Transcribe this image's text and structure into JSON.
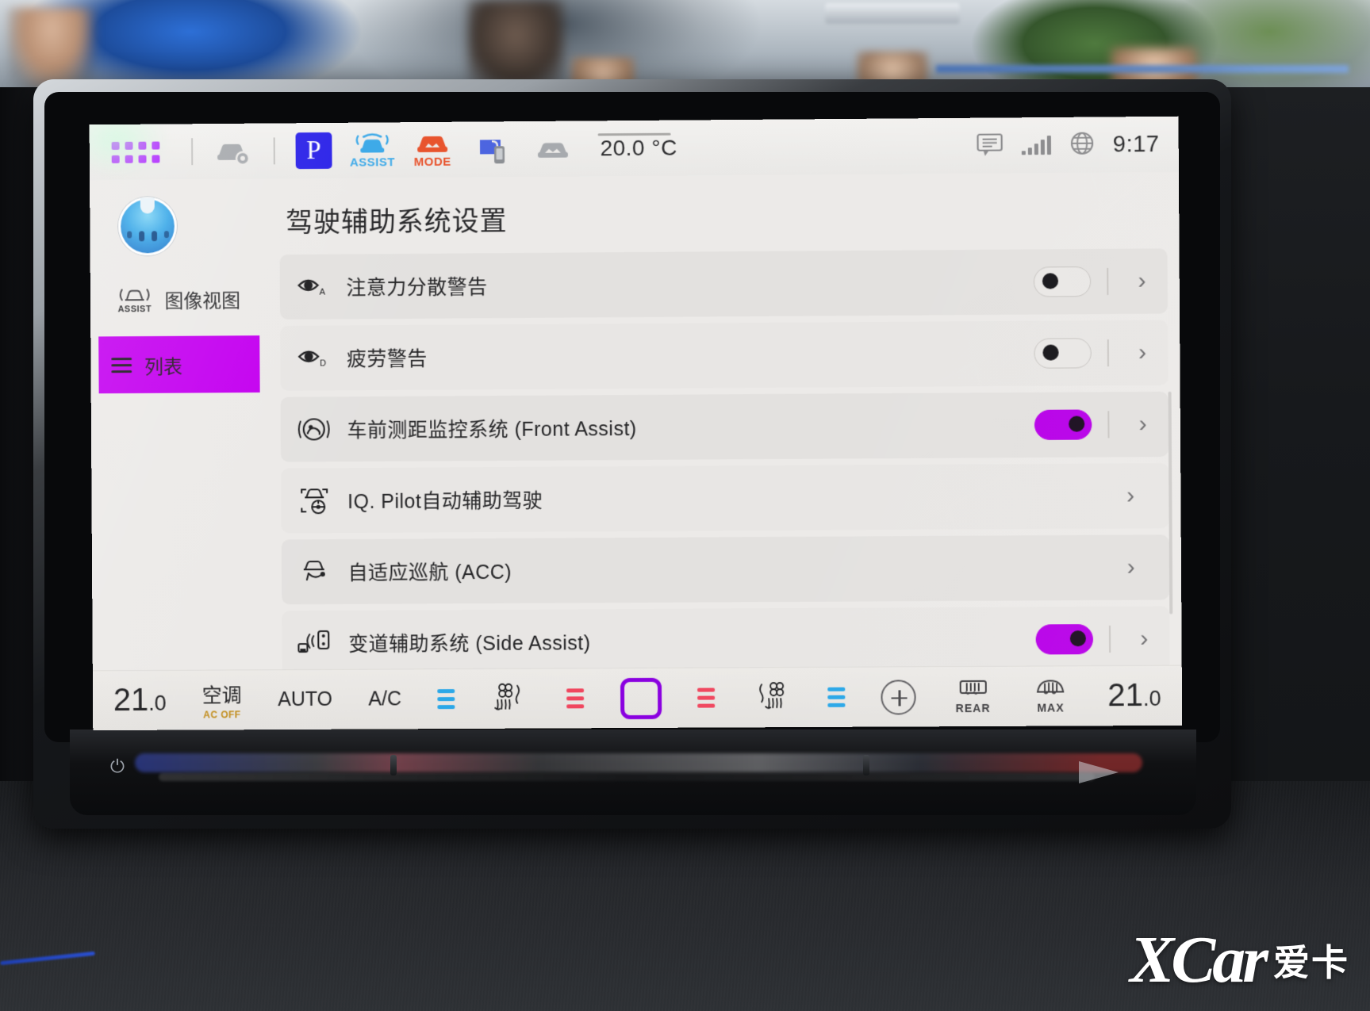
{
  "status_bar": {
    "apps_icon": "app-grid-icon",
    "car_settings_icon": "car-settings-icon",
    "park_label": "P",
    "assist_label": "ASSIST",
    "mode_label": "MODE",
    "phone_icon": "phone-projection-icon",
    "car_icon": "car-front-icon",
    "temperature": "20.0 °C",
    "message_icon": "message-icon",
    "signal_icon": "signal-bars-icon",
    "globe_icon": "globe-icon",
    "clock": "9:17"
  },
  "sidebar": {
    "avatar": "driver-profile-avatar",
    "items": [
      {
        "label": "图像视图",
        "icon": "assist-view-icon",
        "active": false
      },
      {
        "label": "列表",
        "icon": "hamburger-list-icon",
        "active": true
      }
    ]
  },
  "main": {
    "title": "驾驶辅助系统设置",
    "rows": [
      {
        "label": "注意力分散警告",
        "icon": "eye-attention-icon",
        "has_toggle": true,
        "toggle_on": false,
        "has_chevron": true
      },
      {
        "label": "疲劳警告",
        "icon": "eye-drowsy-icon",
        "has_toggle": true,
        "toggle_on": false,
        "has_chevron": true
      },
      {
        "label": "车前测距监控系统 (Front Assist)",
        "icon": "front-assist-icon",
        "has_toggle": true,
        "toggle_on": true,
        "has_chevron": true
      },
      {
        "label": "IQ. Pilot自动辅助驾驶",
        "icon": "iq-pilot-icon",
        "has_toggle": false,
        "toggle_on": false,
        "has_chevron": true
      },
      {
        "label": "自适应巡航 (ACC)",
        "icon": "acc-cruise-icon",
        "has_toggle": false,
        "toggle_on": false,
        "has_chevron": true
      },
      {
        "label": "变道辅助系统 (Side Assist)",
        "icon": "side-assist-icon",
        "has_toggle": true,
        "toggle_on": true,
        "has_chevron": true
      }
    ],
    "chevron_glyph": "›"
  },
  "climate": {
    "left_temp": "21",
    "left_temp_decimal": ".0",
    "ac_label": "空调",
    "ac_status": "AC OFF",
    "auto_label": "AUTO",
    "ac_toggle_label": "A/C",
    "left_fan_bars_color": "#2aa7e8",
    "left_seat_icon": "seat-heat-left-icon",
    "left_red_bars_color": "#f0475f",
    "center_button_icon": "climate-sync-square-icon",
    "center_button_color": "#8a00e0",
    "right_red_bars_color": "#f0475f",
    "right_seat_icon": "seat-heat-right-icon",
    "right_fan_bars_color": "#2aa7e8",
    "plus_icon": "plus-icon",
    "rear_defrost_label": "REAR",
    "max_defrost_label": "MAX",
    "right_temp": "21",
    "right_temp_decimal": ".0"
  },
  "watermark": {
    "brand": "XCar",
    "brand_cn": "爱卡"
  },
  "colors": {
    "accent_purple": "#c400f0",
    "toggle_on": "#b800e8",
    "park_blue": "#2a21e8",
    "mode_orange": "#e8512a",
    "assist_blue": "#3aa8e8",
    "screen_bg": "#eceae8",
    "row_bg": "#e3e1df"
  }
}
